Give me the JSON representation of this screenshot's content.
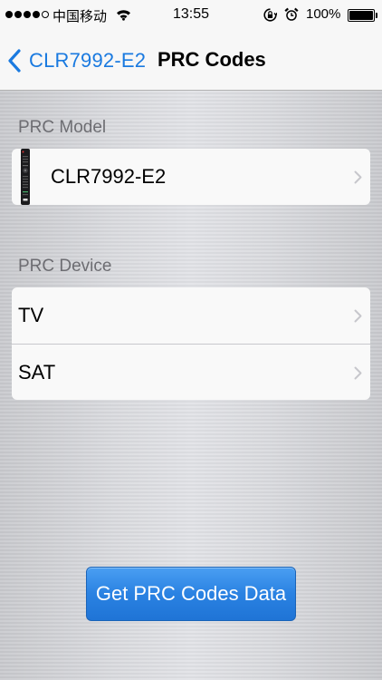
{
  "status_bar": {
    "carrier": "中国移动",
    "time": "13:55",
    "battery": "100%",
    "signal_bars_filled": 4,
    "signal_bars_total": 5
  },
  "nav": {
    "back_label": "CLR7992-E2",
    "title": "PRC Codes"
  },
  "model_section": {
    "header": "PRC Model",
    "item_label": "CLR7992-E2"
  },
  "device_section": {
    "header": "PRC Device",
    "items": [
      {
        "label": "TV"
      },
      {
        "label": "SAT"
      }
    ]
  },
  "action": {
    "button_label": "Get PRC Codes Data"
  },
  "colors": {
    "accent": "#1a7ae0",
    "button": "#2a82e2"
  },
  "icons": {
    "back": "chevron-left-icon",
    "disclosure": "chevron-right-icon",
    "remote": "remote-control-icon",
    "wifi": "wifi-icon",
    "rotation_lock": "rotation-lock-icon",
    "alarm": "alarm-icon",
    "battery": "battery-icon"
  }
}
